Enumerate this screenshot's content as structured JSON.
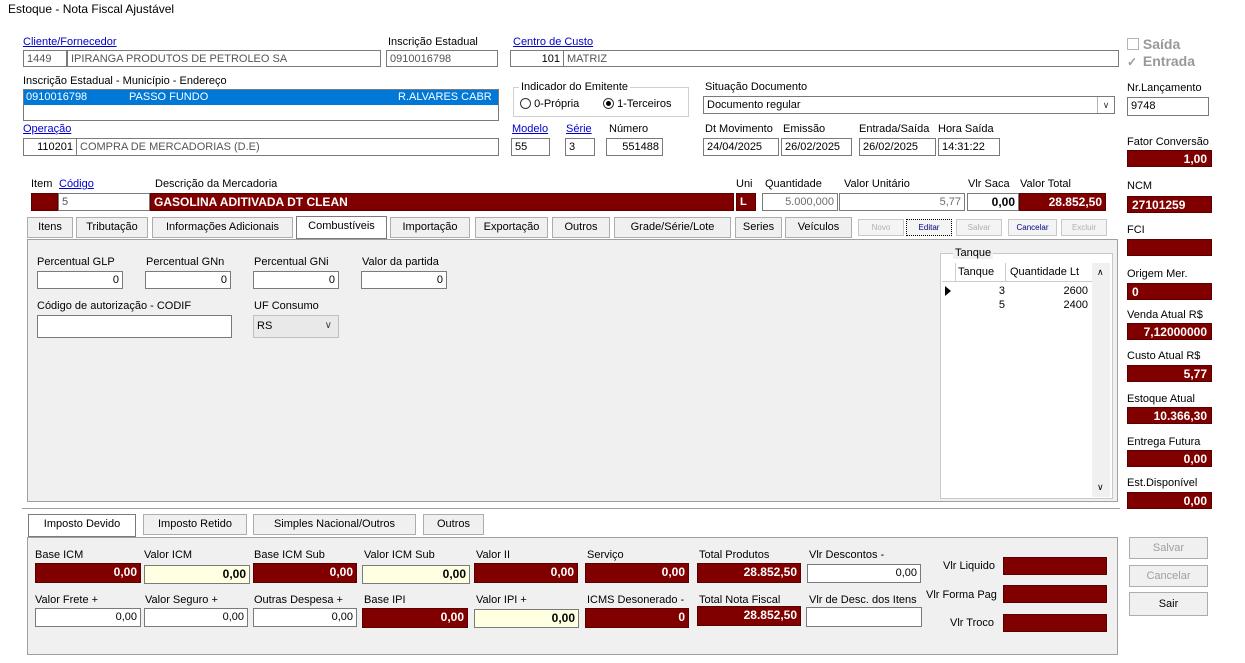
{
  "window_title": "Estoque - Nota Fiscal Ajustável",
  "header": {
    "cliente_label": "Cliente/Fornecedor",
    "cliente_codigo": "1449",
    "cliente_nome": "IPIRANGA PRODUTOS DE PETROLEO SA",
    "inscricao_label": "Inscrição Estadual",
    "inscricao_value": "0910016798",
    "centro_label": "Centro de Custo",
    "centro_codigo": "101",
    "centro_nome": "MATRIZ",
    "ie_mun_end_label": "Inscrição Estadual - Município - Endereço",
    "ie_row_ie": "0910016798",
    "ie_row_municipio": "PASSO FUNDO",
    "ie_row_endereco": "R.ALVARES CABR",
    "indicador_label": "Indicador do Emitente",
    "opt_propria": "0-Própria",
    "opt_terceiros": "1-Terceiros",
    "situacao_label": "Situação Documento",
    "situacao_value": "Documento regular",
    "operacao_label": "Operação",
    "operacao_codigo": "110201",
    "operacao_nome": "COMPRA DE MERCADORIAS (D.E)",
    "modelo_label": "Modelo",
    "modelo_value": "55",
    "serie_label": "Série",
    "serie_value": "3",
    "numero_label": "Número",
    "numero_value": "551488",
    "dt_mov_label": "Dt Movimento",
    "dt_mov_value": "24/04/2025",
    "emissao_label": "Emissão",
    "emissao_value": "26/02/2025",
    "entrada_saida_label": "Entrada/Saída",
    "entrada_saida_value": "26/02/2025",
    "hora_saida_label": "Hora Saída",
    "hora_saida_value": "14:31:22"
  },
  "right_panel": {
    "saida_label": "Saída",
    "entrada_label": "Entrada",
    "nr_lancamento_label": "Nr.Lançamento",
    "nr_lancamento_value": "9748",
    "fator_label": "Fator Conversão",
    "fator_value": "1,00",
    "ncm_label": "NCM",
    "ncm_value": "27101259",
    "fci_label": "FCI",
    "fci_value": "",
    "origem_label": "Origem Mer.",
    "origem_value": "0",
    "venda_label": "Venda Atual R$",
    "venda_value": "7,12000000",
    "custo_label": "Custo Atual R$",
    "custo_value": "5,77",
    "estoque_label": "Estoque Atual",
    "estoque_value": "10.366,30",
    "entrega_label": "Entrega Futura",
    "entrega_value": "0,00",
    "disponivel_label": "Est.Disponível",
    "disponivel_value": "0,00",
    "btn_salvar": "Salvar",
    "btn_cancelar": "Cancelar",
    "btn_sair": "Sair"
  },
  "item": {
    "item_label": "Item",
    "codigo_label": "Código",
    "codigo_value": "5",
    "descricao_label": "Descrição da Mercadoria",
    "descricao_value": "GASOLINA ADITIVADA DT CLEAN",
    "uni_label": "Uni",
    "uni_value": "L",
    "quantidade_label": "Quantidade",
    "quantidade_value": "5.000,000",
    "valor_unit_label": "Valor Unitário",
    "valor_unit_value": "5,77",
    "vlr_saca_label": "Vlr Saca",
    "vlr_saca_value": "0,00",
    "valor_total_label": "Valor Total",
    "valor_total_value": "28.852,50"
  },
  "tabs": {
    "itens": "Itens",
    "tributacao": "Tributação",
    "info_adic": "Informações Adicionais",
    "combustiveis": "Combustíveis",
    "importacao": "Importação",
    "exportacao": "Exportação",
    "outros": "Outros",
    "grade": "Grade/Série/Lote",
    "series": "Series",
    "veiculos": "Veículos",
    "novo": "Novo",
    "editar": "Editar",
    "salvar": "Salvar",
    "cancelar": "Cancelar",
    "excluir": "Excluir"
  },
  "combustiveis": {
    "glp_label": "Percentual GLP",
    "glp_value": "0",
    "gnn_label": "Percentual GNn",
    "gnn_value": "0",
    "gni_label": "Percentual GNi",
    "gni_value": "0",
    "partida_label": "Valor da partida",
    "partida_value": "0",
    "codif_label": "Código de autorização - CODIF",
    "codif_value": "",
    "uf_label": "UF Consumo",
    "uf_value": "RS"
  },
  "tanque": {
    "group_label": "Tanque",
    "col_tanque": "Tanque",
    "col_qtd": "Quantidade Lt",
    "rows": [
      {
        "tanque": "3",
        "qtd": "2600"
      },
      {
        "tanque": "5",
        "qtd": "2400"
      }
    ]
  },
  "bottom_tabs": {
    "imposto_devido": "Imposto Devido",
    "imposto_retido": "Imposto Retido",
    "simples": "Simples Nacional/Outros",
    "outros": "Outros"
  },
  "totais": {
    "base_icm_label": "Base ICM",
    "base_icm": "0,00",
    "valor_icm_label": "Valor ICM",
    "valor_icm": "0,00",
    "base_icm_sub_label": "Base ICM Sub",
    "base_icm_sub": "0,00",
    "valor_icm_sub_label": "Valor ICM Sub",
    "valor_icm_sub": "0,00",
    "valor_ii_label": "Valor II",
    "valor_ii": "0,00",
    "servico_label": "Serviço",
    "servico": "0,00",
    "total_produtos_label": "Total Produtos",
    "total_produtos": "28.852,50",
    "vlr_descontos_label": "Vlr Descontos -",
    "vlr_descontos": "0,00",
    "valor_frete_label": "Valor Frete +",
    "valor_frete": "0,00",
    "valor_seguro_label": "Valor Seguro +",
    "valor_seguro": "0,00",
    "outras_desp_label": "Outras Despesa +",
    "outras_desp": "0,00",
    "base_ipi_label": "Base IPI",
    "base_ipi": "0,00",
    "valor_ipi_label": "Valor IPI +",
    "valor_ipi": "0,00",
    "icms_deson_label": "ICMS Desonerado -",
    "icms_deson": "0",
    "total_nf_label": "Total Nota Fiscal",
    "total_nf": "28.852,50",
    "vlr_desc_itens_label": "Vlr de Desc. dos Itens",
    "vlr_desc_itens": "",
    "vlr_liquido_label": "Vlr Liquido",
    "vlr_liquido": "",
    "vlr_forma_pag_label": "Vlr Forma Pag",
    "vlr_forma_pag": "",
    "vlr_troco_label": "Vlr Troco",
    "vlr_troco": ""
  }
}
